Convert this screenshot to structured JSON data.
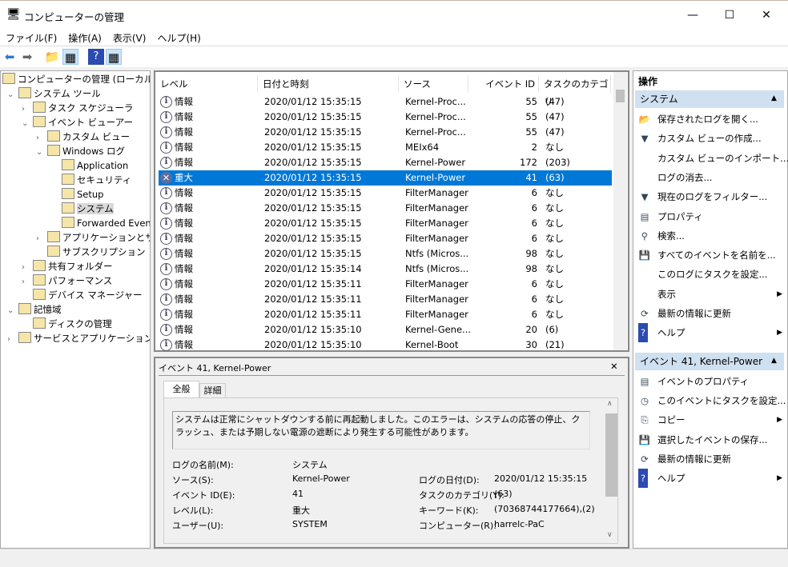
{
  "window": {
    "title": "コンピューターの管理",
    "minimize": "—",
    "maximize": "☐",
    "close": "✕"
  },
  "menu": [
    "ファイル(F)",
    "操作(A)",
    "表示(V)",
    "ヘルプ(H)"
  ],
  "tree": [
    {
      "label": "コンピューターの管理 (ローカル)",
      "level": 0,
      "chev": ""
    },
    {
      "label": "システム ツール",
      "level": 1,
      "chev": "⌄"
    },
    {
      "label": "タスク スケジューラ",
      "level": 2,
      "chev": "›"
    },
    {
      "label": "イベント ビューアー",
      "level": 2,
      "chev": "⌄"
    },
    {
      "label": "カスタム ビュー",
      "level": 3,
      "chev": "›"
    },
    {
      "label": "Windows ログ",
      "level": 3,
      "chev": "⌄"
    },
    {
      "label": "Application",
      "level": 4,
      "chev": ""
    },
    {
      "label": "セキュリティ",
      "level": 4,
      "chev": ""
    },
    {
      "label": "Setup",
      "level": 4,
      "chev": ""
    },
    {
      "label": "システム",
      "level": 4,
      "chev": "",
      "selected": true
    },
    {
      "label": "Forwarded Events",
      "level": 4,
      "chev": ""
    },
    {
      "label": "アプリケーションとサービス ログ",
      "level": 3,
      "chev": "›"
    },
    {
      "label": "サブスクリプション",
      "level": 3,
      "chev": ""
    },
    {
      "label": "共有フォルダー",
      "level": 2,
      "chev": "›"
    },
    {
      "label": "パフォーマンス",
      "level": 2,
      "chev": "›"
    },
    {
      "label": "デバイス マネージャー",
      "level": 2,
      "chev": ""
    },
    {
      "label": "記憶域",
      "level": 1,
      "chev": "⌄"
    },
    {
      "label": "ディスクの管理",
      "level": 2,
      "chev": ""
    },
    {
      "label": "サービスとアプリケーション",
      "level": 1,
      "chev": "›"
    }
  ],
  "columns": [
    "レベル",
    "日付と時刻",
    "ソース",
    "イベント ID",
    "タスクのカテゴリ"
  ],
  "events": [
    [
      "情報",
      "2020/01/12 15:35:15",
      "Kernel-Proc...",
      "55",
      "(47)"
    ],
    [
      "情報",
      "2020/01/12 15:35:15",
      "Kernel-Proc...",
      "55",
      "(47)"
    ],
    [
      "情報",
      "2020/01/12 15:35:15",
      "Kernel-Proc...",
      "55",
      "(47)"
    ],
    [
      "情報",
      "2020/01/12 15:35:15",
      "MEIx64",
      "2",
      "なし"
    ],
    [
      "情報",
      "2020/01/12 15:35:15",
      "Kernel-Power",
      "172",
      "(203)"
    ],
    [
      "重大",
      "2020/01/12 15:35:15",
      "Kernel-Power",
      "41",
      "(63)"
    ],
    [
      "情報",
      "2020/01/12 15:35:15",
      "FilterManager",
      "6",
      "なし"
    ],
    [
      "情報",
      "2020/01/12 15:35:15",
      "FilterManager",
      "6",
      "なし"
    ],
    [
      "情報",
      "2020/01/12 15:35:15",
      "FilterManager",
      "6",
      "なし"
    ],
    [
      "情報",
      "2020/01/12 15:35:15",
      "FilterManager",
      "6",
      "なし"
    ],
    [
      "情報",
      "2020/01/12 15:35:15",
      "Ntfs (Micros...",
      "98",
      "なし"
    ],
    [
      "情報",
      "2020/01/12 15:35:14",
      "Ntfs (Micros...",
      "98",
      "なし"
    ],
    [
      "情報",
      "2020/01/12 15:35:11",
      "FilterManager",
      "6",
      "なし"
    ],
    [
      "情報",
      "2020/01/12 15:35:11",
      "FilterManager",
      "6",
      "なし"
    ],
    [
      "情報",
      "2020/01/12 15:35:11",
      "FilterManager",
      "6",
      "なし"
    ],
    [
      "情報",
      "2020/01/12 15:35:10",
      "Kernel-Gene...",
      "20",
      "(6)"
    ],
    [
      "情報",
      "2020/01/12 15:35:10",
      "Kernel-Boot",
      "30",
      "(21)"
    ]
  ],
  "detail": {
    "title": "イベント 41, Kernel-Power",
    "close": "✕",
    "tabs": [
      "全般",
      "詳細"
    ],
    "message": "システムは正常にシャットダウンする前に再起動しました。このエラーは、システムの応答の停止、クラッシュ、または予期しない電源の遮断により発生する可能性があります。",
    "fields": [
      [
        "ログの名前(M):",
        "システム",
        "",
        ""
      ],
      [
        "ソース(S):",
        "Kernel-Power",
        "ログの日付(D):",
        "2020/01/12 15:35:15"
      ],
      [
        "イベント ID(E):",
        "41",
        "タスクのカテゴリ(Y):",
        "(63)"
      ],
      [
        "レベル(L):",
        "重大",
        "キーワード(K):",
        "(70368744177664),(2)"
      ],
      [
        "ユーザー(U):",
        "SYSTEM",
        "コンピューター(R):",
        "harrelc-PaC"
      ]
    ]
  },
  "actions": {
    "header": "操作",
    "sections": [
      {
        "title": "システム",
        "items": [
          {
            "icon": "📂",
            "label": "保存されたログを開く...",
            "sub": false
          },
          {
            "icon": "▼",
            "label": "カスタム ビューの作成...",
            "sub": false
          },
          {
            "icon": "",
            "label": "カスタム ビューのインポート...",
            "sub": false
          },
          {
            "icon": "",
            "label": "ログの消去...",
            "sub": false
          },
          {
            "icon": "▼",
            "label": "現在のログをフィルター...",
            "sub": false
          },
          {
            "icon": "▤",
            "label": "プロパティ",
            "sub": false
          },
          {
            "icon": "⚲",
            "label": "検索...",
            "sub": false
          },
          {
            "icon": "💾",
            "label": "すべてのイベントを名前を...",
            "sub": false
          },
          {
            "icon": "",
            "label": "このログにタスクを設定...",
            "sub": false
          },
          {
            "icon": "",
            "label": "表示",
            "sub": true
          },
          {
            "icon": "⟳",
            "label": "最新の情報に更新",
            "sub": false
          },
          {
            "icon": "?",
            "label": "ヘルプ",
            "sub": true
          }
        ]
      },
      {
        "title": "イベント 41, Kernel-Power",
        "items": [
          {
            "icon": "▤",
            "label": "イベントのプロパティ",
            "sub": false
          },
          {
            "icon": "◷",
            "label": "このイベントにタスクを設定...",
            "sub": false
          },
          {
            "icon": "⎘",
            "label": "コピー",
            "sub": true
          },
          {
            "icon": "💾",
            "label": "選択したイベントの保存...",
            "sub": false
          },
          {
            "icon": "⟳",
            "label": "最新の情報に更新",
            "sub": false
          },
          {
            "icon": "?",
            "label": "ヘルプ",
            "sub": true
          }
        ]
      }
    ]
  }
}
